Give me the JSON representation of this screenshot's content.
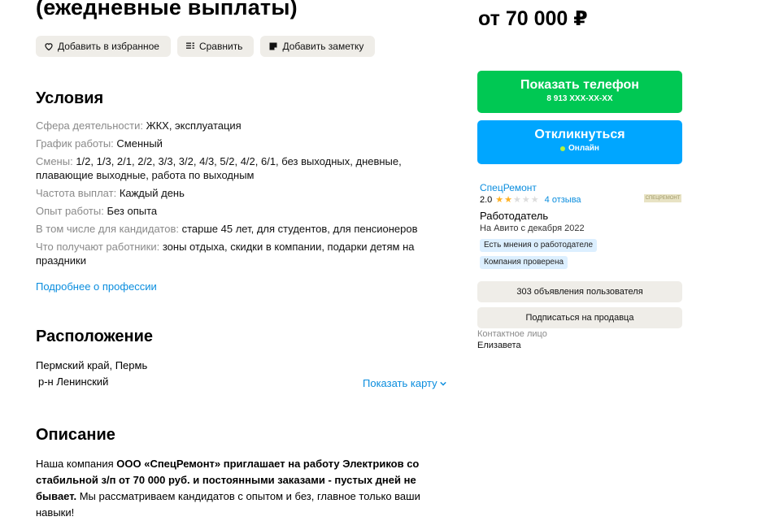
{
  "title": "(ежедневные выплаты)",
  "actions": {
    "favorite": "Добавить в избранное",
    "compare": "Сравнить",
    "note": "Добавить заметку"
  },
  "conditions": {
    "heading": "Условия",
    "rows": [
      {
        "key": "Сфера деятельности:",
        "value": "ЖКХ, эксплуатация"
      },
      {
        "key": "График работы:",
        "value": "Сменный"
      },
      {
        "key": "Смены:",
        "value": "1/2, 1/3, 2/1, 2/2, 3/3, 3/2, 4/3, 5/2, 4/2, 6/1, без выходных, дневные, плавающие выходные, работа по выходным"
      },
      {
        "key": "Частота выплат:",
        "value": "Каждый день"
      },
      {
        "key": "Опыт работы:",
        "value": "Без опыта"
      },
      {
        "key": "В том числе для кандидатов:",
        "value": "старше 45 лет, для студентов, для пенсионеров"
      },
      {
        "key": "Что получают работники:",
        "value": "зоны отдыха, скидки в компании, подарки детям на праздники"
      }
    ],
    "more_link": "Подробнее о профессии"
  },
  "location": {
    "heading": "Расположение",
    "address": "Пермский край, Пермь",
    "district": "р-н Ленинский",
    "show_map": "Показать карту"
  },
  "description": {
    "heading": "Описание",
    "p1_a": "Наша компания ",
    "p1_b": "ООО «СпецРемонт» приглашает на работу Электриков со стабильной з/п от 70 000 руб. и постоянными заказами - пустых дней не бывает.",
    "p1_c": " Мы рассматриваем кандидатов с опытом и без, главное только ваши навыки!"
  },
  "price": "от 70 000 ₽",
  "phone_button": {
    "label": "Показать телефон",
    "sub": "8 913 XXX-XX-XX",
    "color": "#00c853"
  },
  "respond_button": {
    "label": "Откликнуться",
    "sub": "Онлайн",
    "color": "#00a6ff"
  },
  "seller": {
    "name": "СпецРемонт",
    "rating": "2.0",
    "stars_filled": 2,
    "stars_total": 5,
    "reviews": "4 отзыва",
    "logo_text": "СПЕЦРЕМОНТ",
    "role": "Работодатель",
    "since": "На Авито с декабря 2022",
    "badges": [
      "Есть мнения о работодателе",
      "Компания проверена"
    ],
    "ads_button": "303 объявления пользователя",
    "subscribe_button": "Подписаться на продавца",
    "contact_label": "Контактное лицо",
    "contact_name": "Елизавета"
  },
  "icons": {
    "heart": "heart-icon",
    "compare": "compare-icon",
    "note": "note-icon",
    "chevron": "chevron-down-icon",
    "star": "star-icon"
  }
}
